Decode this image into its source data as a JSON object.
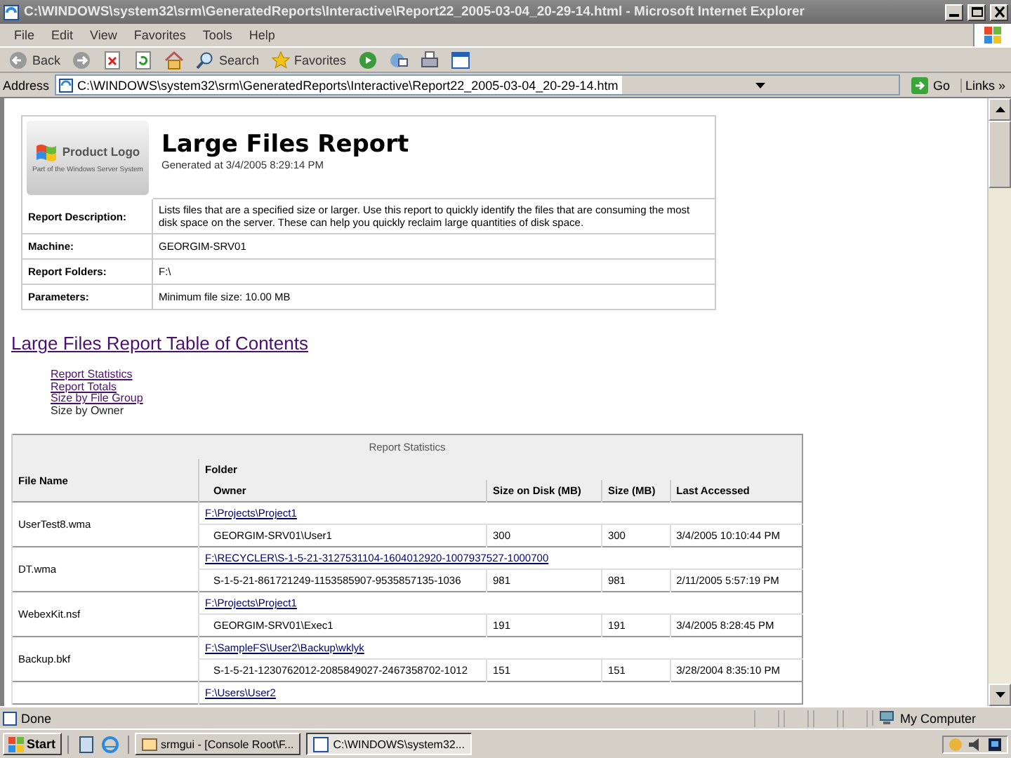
{
  "window": {
    "title": "C:\\WINDOWS\\system32\\srm\\GeneratedReports\\Interactive\\Report22_2005-03-04_20-29-14.html - Microsoft Internet Explorer"
  },
  "menu": [
    "File",
    "Edit",
    "View",
    "Favorites",
    "Tools",
    "Help"
  ],
  "toolbar": [
    {
      "kind": "back",
      "label": "Back"
    },
    {
      "kind": "forward"
    },
    {
      "kind": "stop"
    },
    {
      "kind": "refresh"
    },
    {
      "kind": "home"
    },
    {
      "kind": "search",
      "label": "Search"
    },
    {
      "kind": "favorites",
      "label": "Favorites"
    },
    {
      "kind": "media"
    },
    {
      "kind": "mail"
    },
    {
      "kind": "print"
    },
    {
      "kind": "edit"
    }
  ],
  "address": {
    "label": "Address",
    "value": "C:\\WINDOWS\\system32\\srm\\GeneratedReports\\Interactive\\Report22_2005-03-04_20-29-14.htm",
    "go": "Go",
    "links": "Links",
    "more": "»"
  },
  "report": {
    "logo": {
      "name": "Product Logo",
      "tagline": "Part of the Windows Server System"
    },
    "title": "Large Files Report",
    "generated": "Generated at 3/4/2005 8:29:14 PM",
    "details": [
      {
        "label": "Report Description:",
        "value": "Lists files that are a specified size or larger. Use this report to quickly identify the files that are consuming the most disk space on the server. These can help you quickly reclaim large quantities of disk space."
      },
      {
        "label": "Machine:",
        "value": "GEORGIM-SRV01"
      },
      {
        "label": "Report Folders:",
        "value": "F:\\"
      },
      {
        "label": "Parameters:",
        "value": "Minimum file size: 10.00 MB"
      }
    ]
  },
  "toc": {
    "title": "Large Files Report Table of Contents",
    "items": [
      {
        "label": "Report Statistics",
        "link": true
      },
      {
        "label": "Report Totals",
        "link": true
      },
      {
        "label": "Size by File Group",
        "link": true
      },
      {
        "label": "Size by Owner",
        "link": false
      }
    ]
  },
  "statistics": {
    "title": "Report Statistics",
    "columns": {
      "file": "File Name",
      "folder": "Folder",
      "owner": "Owner",
      "size_on_disk": "Size on Disk (MB)",
      "size": "Size (MB)",
      "accessed": "Last Accessed"
    },
    "rows": [
      {
        "file": "UserTest8.wma",
        "folder": "F:\\Projects\\Project1",
        "owner": "GEORGIM-SRV01\\User1",
        "size_on_disk": "300",
        "size": "300",
        "accessed": "3/4/2005 10:10:44 PM"
      },
      {
        "file": "DT.wma",
        "folder": "F:\\RECYCLER\\S-1-5-21-3127531104-1604012920-1007937527-1000700",
        "owner": "S-1-5-21-861721249-1153585907-9535857135-1036",
        "size_on_disk": "981",
        "size": "981",
        "accessed": "2/11/2005 5:57:19 PM"
      },
      {
        "file": "WebexKit.nsf",
        "folder": "F:\\Projects\\Project1",
        "owner": "GEORGIM-SRV01\\Exec1",
        "size_on_disk": "191",
        "size": "191",
        "accessed": "3/4/2005 8:28:45 PM"
      },
      {
        "file": "Backup.bkf",
        "folder": "F:\\SampleFS\\User2\\Backup\\wklyk",
        "owner": "S-1-5-21-1230762012-2085849027-2467358702-1012",
        "size_on_disk": "151",
        "size": "151",
        "accessed": "3/28/2004 8:35:10 PM"
      },
      {
        "folder": "F:\\Users\\User2"
      }
    ]
  },
  "status_bar": {
    "text": "Done",
    "zone": "My Computer"
  },
  "taskbar": {
    "start": "Start",
    "tasks": [
      {
        "label": "srmgui - [Console Root\\F...",
        "selected": false
      },
      {
        "label": "C:\\WINDOWS\\system32...",
        "selected": true
      }
    ]
  }
}
